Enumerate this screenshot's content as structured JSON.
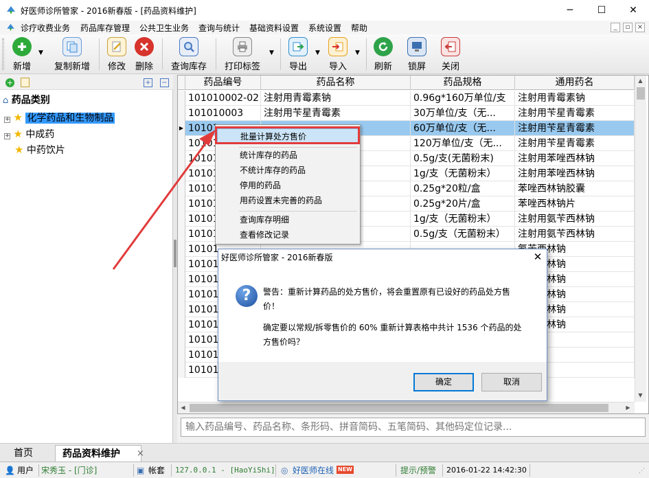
{
  "window": {
    "title": "好医师诊所管家 - 2016新春版 - [药品资料维护]",
    "minimize": "─",
    "maximize": "☐",
    "close": "✕"
  },
  "menu": [
    "诊疗收费业务",
    "药品库存管理",
    "公共卫生业务",
    "查询与统计",
    "基础资料设置",
    "系统设置",
    "帮助"
  ],
  "mdi_controls": [
    "_",
    "▫",
    "×"
  ],
  "toolbar": [
    {
      "label": "新增",
      "icon": "plus-icon",
      "color": "#2eaa3a"
    },
    {
      "label": "复制新增",
      "icon": "copy-icon",
      "color": "#3a8ad6"
    },
    {
      "label": "修改",
      "icon": "edit-icon",
      "color": "#d9a520"
    },
    {
      "label": "删除",
      "icon": "delete-icon",
      "color": "#d6342c"
    },
    {
      "label": "查询库存",
      "icon": "search-stock-icon",
      "color": "#4a78c2"
    },
    {
      "label": "打印标签",
      "icon": "print-icon",
      "color": "#6c6c6c"
    },
    {
      "label": "导出",
      "icon": "export-icon",
      "color": "#2e8fd0"
    },
    {
      "label": "导入",
      "icon": "import-icon",
      "color": "#e6a21c"
    },
    {
      "label": "刷新",
      "icon": "refresh-icon",
      "color": "#2ea34a"
    },
    {
      "label": "锁屏",
      "icon": "lock-screen-icon",
      "color": "#3a6fb0"
    },
    {
      "label": "关闭",
      "icon": "close-window-icon",
      "color": "#c83a3a"
    }
  ],
  "tree": {
    "root": "药品类别",
    "items": [
      "化学药品和生物制品",
      "中成药",
      "中药饮片"
    ]
  },
  "grid": {
    "columns": [
      "药品编号",
      "药品名称",
      "药品规格",
      "通用药名"
    ],
    "rows": [
      [
        "101010002-02",
        "注射用青霉素钠",
        "0.96g*160万单位/支",
        "注射用青霉素钠"
      ],
      [
        "101010003",
        "注射用苄星青霉素",
        "30万单位/支（无...",
        "注射用苄星青霉素"
      ],
      [
        "10101",
        "",
        "60万单位/支（无...",
        "注射用苄星青霉素"
      ],
      [
        "10101",
        "",
        "120万单位/支（无...",
        "注射用苄星青霉素"
      ],
      [
        "10101",
        "",
        "0.5g/支(无菌粉末)",
        "注射用苯唑西林钠"
      ],
      [
        "10101",
        "",
        "1g/支（无菌粉末）",
        "注射用苯唑西林钠"
      ],
      [
        "10101",
        "",
        "0.25g*20粒/盒",
        "苯唑西林钠胶囊"
      ],
      [
        "10101",
        "",
        "0.25g*20片/盒",
        "苯唑西林钠片"
      ],
      [
        "10101",
        "",
        "1g/支（无菌粉末）",
        "注射用氨苄西林钠"
      ],
      [
        "10101",
        "",
        "0.5g/支（无菌粉末）",
        "注射用氨苄西林钠"
      ],
      [
        "10101",
        "",
        "",
        "氨苄西林钠"
      ],
      [
        "10101",
        "",
        "",
        "氨苄西林钠"
      ],
      [
        "10101",
        "",
        "",
        "哌拉西林钠"
      ],
      [
        "10101",
        "",
        "",
        "哌拉西林钠"
      ],
      [
        "10101",
        "",
        "",
        "哌拉西林钠"
      ],
      [
        "10101",
        "",
        "",
        "哌拉西林钠"
      ],
      [
        "10101",
        "",
        "",
        "林胶囊"
      ],
      [
        "10101",
        "",
        "",
        "林胶囊"
      ],
      [
        "10101",
        "",
        "",
        "林胶囊"
      ]
    ]
  },
  "context_menu": {
    "items": [
      "批量计算处方售价",
      "统计库存的药品",
      "不统计库存的药品",
      "停用的药品",
      "用药设置未完善的药品",
      "查询库存明细",
      "查看修改记录"
    ]
  },
  "dialog": {
    "title": "好医师诊所管家 - 2016新春版",
    "close": "✕",
    "icon": "question-icon",
    "warning": "警告：重新计算药品的处方售价，将会重置原有已设好的药品处方售价！",
    "confirm": "确定要以常规/拆零售价的 60% 重新计算表格中共计 1536 个药品的处方售价吗？",
    "ok": "确定",
    "cancel": "取消"
  },
  "search": {
    "placeholder": "输入药品编号、药品名称、条形码、拼音简码、五笔简码、其他码定位记录..."
  },
  "tabs": [
    "首页",
    "药品资料维护"
  ],
  "tab_close": "×",
  "status": {
    "user_label": "用户",
    "user": "宋秀玉 - [门诊]",
    "account_label": "帐套",
    "server": "127.0.0.1 - [HaoYiShi]",
    "online": "好医师在线",
    "new_badge": "NEW",
    "tips": "提示/预警",
    "datetime": "2016-01-22 14:42:30"
  },
  "colors": {
    "selection": "#99c9ef",
    "highlight_box": "#e23b3b",
    "arrow": "#e23b3b"
  }
}
